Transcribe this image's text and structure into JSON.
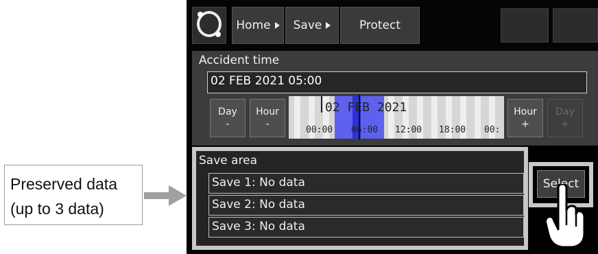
{
  "callout": {
    "line1": "Preserved data",
    "line2": "(up to 3 data)"
  },
  "nav": {
    "home": "Home",
    "save": "Save",
    "protect": "Protect"
  },
  "accident": {
    "label": "Accident time",
    "value": "02 FEB 2021 05:00"
  },
  "step_buttons": {
    "day_minus": [
      "Day",
      "-"
    ],
    "hour_minus": [
      "Hour",
      "-"
    ],
    "hour_plus": [
      "Hour",
      "+"
    ],
    "day_plus": [
      "Day",
      "+"
    ]
  },
  "timeline": {
    "date": "02 FEB 2021",
    "ticks": [
      "00:00",
      "06:00",
      "12:00",
      "18:00",
      "00:"
    ]
  },
  "save_area": {
    "title": "Save area",
    "slots": [
      "Save 1: No data",
      "Save 2: No data",
      "Save 3: No data"
    ],
    "select_label": "Select"
  },
  "icons": [
    "app-logo-icon",
    "chevron-right-icon",
    "hand-pointer-icon"
  ],
  "colors": {
    "timeline_highlight": "#5d61ee",
    "frame": "#c8c8c8",
    "screen_bg": "#000000"
  }
}
